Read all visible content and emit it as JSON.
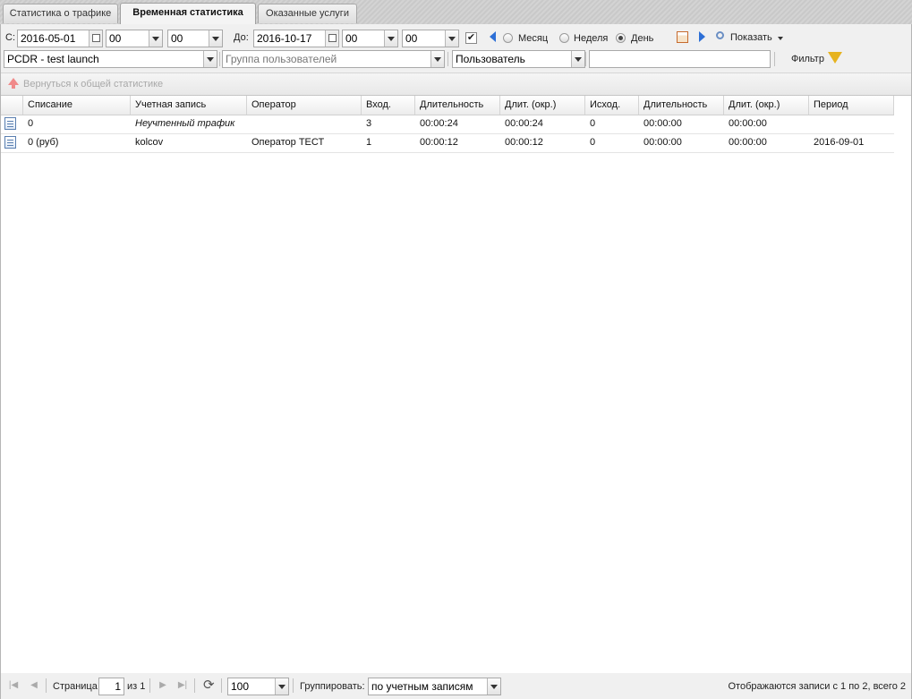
{
  "tabs": [
    {
      "label": "Статистика о трафике",
      "active": false
    },
    {
      "label": "Временная статистика",
      "active": true
    },
    {
      "label": "Оказанные услуги",
      "active": false
    }
  ],
  "filters": {
    "from_label": "С:",
    "from_date": "2016-05-01",
    "from_hour": "00",
    "from_minute": "00",
    "to_label": "До:",
    "to_date": "2016-10-17",
    "to_hour": "00",
    "to_minute": "00",
    "checkbox_checked": true,
    "period_options": [
      "Месяц",
      "Неделя",
      "День"
    ],
    "period_selected": "День",
    "show_label": "Показать",
    "operator_value": "PCDR - test launch",
    "group_placeholder": "Группа пользователей",
    "user_value": "Пользователь",
    "search_value": "",
    "filter_label": "Фильтр"
  },
  "back_link": "Вернуться к общей статистике",
  "grid": {
    "columns": [
      "Списание",
      "Учетная запись",
      "Оператор",
      "Вход.",
      "Длительность",
      "Длит. (окр.)",
      "Исход.",
      "Длительность",
      "Длит. (окр.)",
      "Период"
    ],
    "rows": [
      [
        "0",
        "Неучтенный трафик",
        "",
        "3",
        "00:00:24",
        "00:00:24",
        "0",
        "00:00:00",
        "00:00:00",
        ""
      ],
      [
        "0 (руб)",
        "kolcov",
        "Оператор ТЕСТ",
        "1",
        "00:00:12",
        "00:00:12",
        "0",
        "00:00:00",
        "00:00:00",
        "2016-09-01"
      ]
    ]
  },
  "paging": {
    "page_label": "Страница",
    "page_value": "1",
    "of_label": "из 1",
    "page_size": "100",
    "group_label": "Группировать:",
    "group_value": "по учетным записям",
    "summary": "Отображаются записи с 1 по 2, всего 2"
  }
}
